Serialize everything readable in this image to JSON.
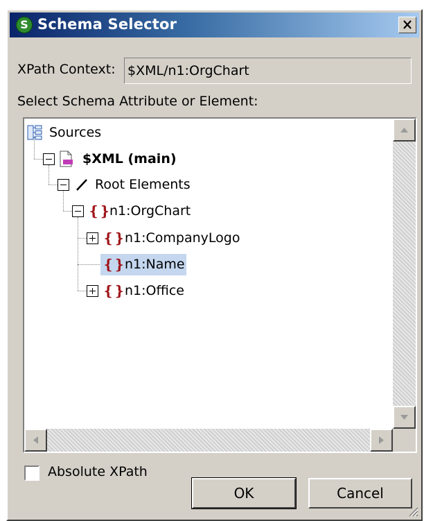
{
  "window": {
    "title": "Schema Selector",
    "app_icon_glyph": "S",
    "close_glyph": "×"
  },
  "xpath_context": {
    "label": "XPath Context:",
    "value": "$XML/n1:OrgChart"
  },
  "tree_label": "Select Schema Attribute or Element:",
  "tree": {
    "items": [
      {
        "label": "Sources",
        "icon": "sources-icon"
      },
      {
        "label": "$XML (main)",
        "icon": "xml-file-icon",
        "bold": true
      },
      {
        "label": "Root Elements",
        "icon": "slash-icon"
      },
      {
        "label": "n1:OrgChart",
        "icon": "element-braces-icon"
      },
      {
        "label": "n1:CompanyLogo",
        "icon": "element-braces-icon"
      },
      {
        "label": "n1:Name",
        "icon": "element-braces-icon",
        "selected": true
      },
      {
        "label": "n1:Office",
        "icon": "element-braces-icon"
      }
    ],
    "braces_glyph": "{}",
    "slash_glyph": "/"
  },
  "absolute_xpath": {
    "label": "Absolute XPath",
    "checked": false
  },
  "buttons": {
    "ok": "OK",
    "cancel": "Cancel"
  },
  "colors": {
    "titlebar_start": "#0a246a",
    "titlebar_end": "#a6caf0",
    "selection": "#c4d7ef",
    "element_icon": "#a0161a",
    "dialog_face": "#d4d0c8"
  }
}
